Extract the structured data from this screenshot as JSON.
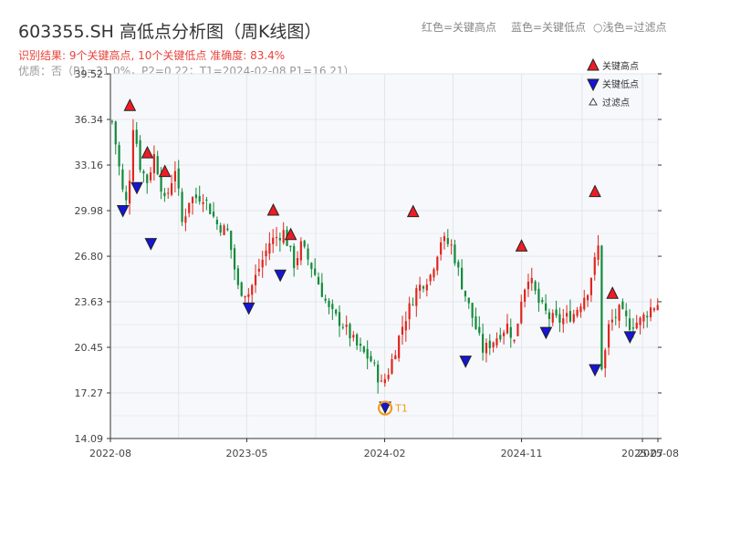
{
  "header": {
    "title": "603355.SH 高低点分析图（周K线图）",
    "legend_red": "红色=关键高点",
    "legend_blue": "蓝色=关键低点",
    "legend_light": "○浅色=过滤点",
    "result_line": "识别结果: 9个关键高点, 10个关键低点   准确度: 83.4%",
    "quality_line": "优质：否（P1=31.0%，P2=0.22；T1=2024-02-08 P1=16.21）"
  },
  "colors": {
    "up": "#e0261f",
    "down": "#128a3a",
    "high_marker": "#ee1c24",
    "low_marker": "#1515d6",
    "t1_ring": "#f39a1e",
    "plot_bg": "#f6f8fb",
    "grid": "#e2e6ec"
  },
  "chart_data": {
    "type": "candlestick",
    "interval": "weekly",
    "ylim": [
      14.09,
      39.52
    ],
    "yticks": [
      14.09,
      17.27,
      20.45,
      23.63,
      26.8,
      29.98,
      33.16,
      36.34,
      39.52
    ],
    "ytick_labels": [
      "14.09",
      "17.27",
      "20.45",
      "23.63",
      "26.80",
      "29.98",
      "33.16",
      "36.34",
      "39.52"
    ],
    "xlim": [
      "2022-08-01",
      "2025-08-01"
    ],
    "xticks": [
      "2022-08-01",
      "2023-05-01",
      "2024-02-01",
      "2024-11-01",
      "2025-07-01",
      "2025-08-01"
    ],
    "xtick_labels": [
      "2022-08",
      "2023-05",
      "2024-02",
      "2024-11",
      "2025-07",
      "2025-08"
    ],
    "close_path": [
      [
        "2022-08-05",
        36.2
      ],
      [
        "2022-08-26",
        31.2
      ],
      [
        "2022-09-02",
        30.5
      ],
      [
        "2022-09-09",
        32.5
      ],
      [
        "2022-09-16",
        36.2
      ],
      [
        "2022-09-30",
        33.0
      ],
      [
        "2022-10-14",
        32.0
      ],
      [
        "2022-10-28",
        33.9
      ],
      [
        "2022-11-18",
        30.5
      ],
      [
        "2022-12-09",
        33.0
      ],
      [
        "2022-12-23",
        29.0
      ],
      [
        "2023-01-06",
        30.8
      ],
      [
        "2023-02-03",
        31.0
      ],
      [
        "2023-03-03",
        29.0
      ],
      [
        "2023-03-24",
        28.5
      ],
      [
        "2023-04-14",
        24.5
      ],
      [
        "2023-05-05",
        24.2
      ],
      [
        "2023-05-26",
        26.0
      ],
      [
        "2023-06-16",
        27.8
      ],
      [
        "2023-07-14",
        28.5
      ],
      [
        "2023-08-04",
        26.2
      ],
      [
        "2023-08-18",
        27.6
      ],
      [
        "2023-09-15",
        25.5
      ],
      [
        "2023-10-13",
        23.0
      ],
      [
        "2023-11-10",
        22.0
      ],
      [
        "2023-12-08",
        20.5
      ],
      [
        "2024-01-05",
        19.5
      ],
      [
        "2024-01-26",
        17.8
      ],
      [
        "2024-02-09",
        18.8
      ],
      [
        "2024-03-08",
        22.0
      ],
      [
        "2024-04-05",
        24.5
      ],
      [
        "2024-05-03",
        25.5
      ],
      [
        "2024-05-24",
        28.0
      ],
      [
        "2024-06-14",
        27.5
      ],
      [
        "2024-07-05",
        24.8
      ],
      [
        "2024-07-26",
        22.5
      ],
      [
        "2024-08-16",
        20.2
      ],
      [
        "2024-09-13",
        21.2
      ],
      [
        "2024-10-04",
        22.0
      ],
      [
        "2024-10-18",
        20.8
      ],
      [
        "2024-11-01",
        24.0
      ],
      [
        "2024-11-15",
        25.5
      ],
      [
        "2024-12-06",
        23.5
      ],
      [
        "2024-12-27",
        22.5
      ],
      [
        "2025-01-17",
        22.3
      ],
      [
        "2025-02-14",
        22.8
      ],
      [
        "2025-03-14",
        24.5
      ],
      [
        "2025-04-04",
        27.5
      ],
      [
        "2025-04-11",
        18.5
      ],
      [
        "2025-04-25",
        22.0
      ],
      [
        "2025-05-16",
        23.0
      ],
      [
        "2025-06-06",
        22.0
      ],
      [
        "2025-06-27",
        22.3
      ],
      [
        "2025-07-18",
        23.2
      ],
      [
        "2025-08-01",
        23.5
      ]
    ],
    "key_highs": [
      {
        "date": "2022-09-09",
        "price": 36.9
      },
      {
        "date": "2022-10-14",
        "price": 33.6
      },
      {
        "date": "2022-11-18",
        "price": 32.3
      },
      {
        "date": "2023-06-23",
        "price": 29.6
      },
      {
        "date": "2023-07-28",
        "price": 27.9
      },
      {
        "date": "2024-03-29",
        "price": 29.5
      },
      {
        "date": "2024-11-01",
        "price": 27.1
      },
      {
        "date": "2025-03-28",
        "price": 30.9
      },
      {
        "date": "2025-05-02",
        "price": 23.8
      }
    ],
    "key_lows": [
      {
        "date": "2022-08-26",
        "price": 30.4
      },
      {
        "date": "2022-09-23",
        "price": 32.0
      },
      {
        "date": "2022-10-21",
        "price": 28.1
      },
      {
        "date": "2023-05-05",
        "price": 23.6
      },
      {
        "date": "2023-07-07",
        "price": 25.9
      },
      {
        "date": "2024-02-02",
        "price": 16.7
      },
      {
        "date": "2024-07-12",
        "price": 19.9
      },
      {
        "date": "2024-12-20",
        "price": 21.9
      },
      {
        "date": "2025-03-28",
        "price": 19.3
      },
      {
        "date": "2025-06-06",
        "price": 21.6
      }
    ],
    "t1": {
      "date": "2024-02-02",
      "price": 16.21,
      "label": "T1"
    },
    "legend": [
      {
        "marker": "high",
        "label": "关键高点"
      },
      {
        "marker": "low",
        "label": "关键低点"
      },
      {
        "marker": "filtered",
        "label": "过滤点"
      }
    ]
  }
}
